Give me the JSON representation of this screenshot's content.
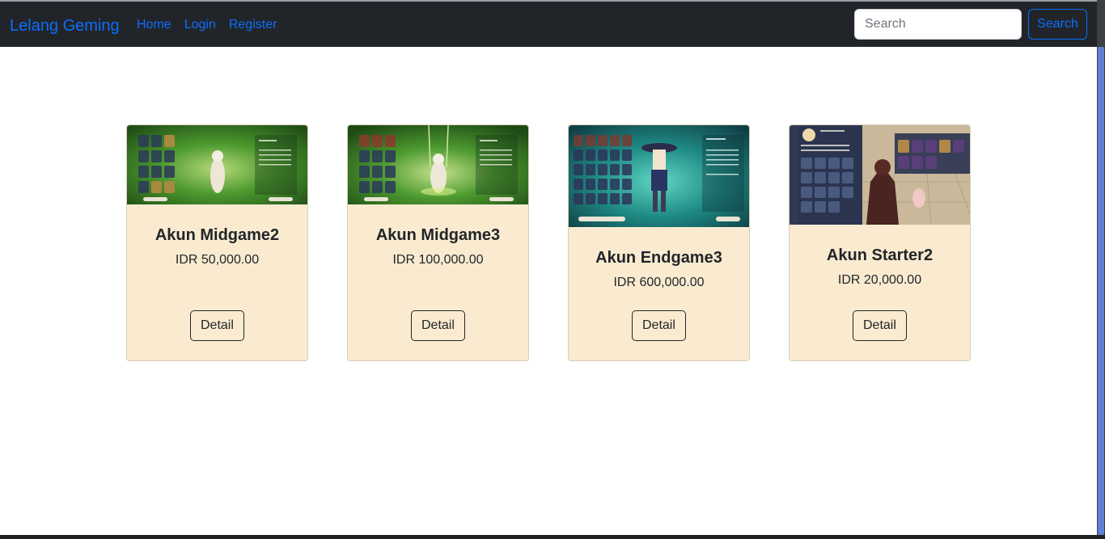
{
  "navbar": {
    "brand": "Lelang Geming",
    "links": [
      "Home",
      "Login",
      "Register"
    ],
    "search_placeholder": "Search",
    "search_button": "Search"
  },
  "products": [
    {
      "title": "Akun Midgame2",
      "price": "IDR 50,000.00",
      "button": "Detail"
    },
    {
      "title": "Akun Midgame3",
      "price": "IDR 100,000.00",
      "button": "Detail"
    },
    {
      "title": "Akun Endgame3",
      "price": "IDR 600,000.00",
      "button": "Detail"
    },
    {
      "title": "Akun Starter2",
      "price": "IDR 20,000.00",
      "button": "Detail"
    }
  ],
  "colors": {
    "navbar_bg": "#212529",
    "link": "#0d6efd",
    "card_bg": "#faebd0"
  }
}
